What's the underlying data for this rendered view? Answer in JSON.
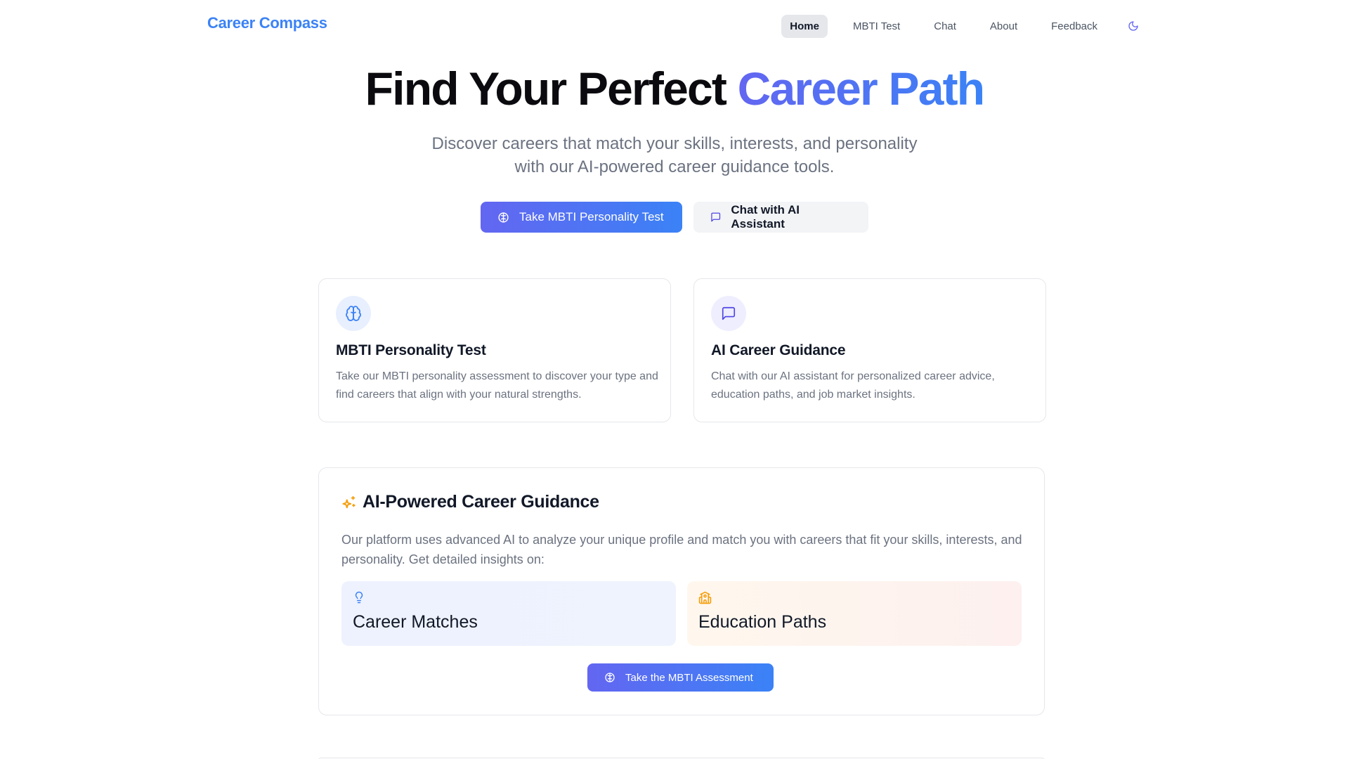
{
  "nav": {
    "brand": "Career Compass",
    "links": [
      "Home",
      "MBTI Test",
      "Chat",
      "About",
      "Feedback"
    ],
    "active": "Home",
    "theme_icon": "moon-icon"
  },
  "hero": {
    "title_main": "Find Your Perfect ",
    "title_accent": "Career Path",
    "subtitle_line1": "Discover careers that match your skills, interests, and personality",
    "subtitle_line2": "with our AI-powered career guidance tools.",
    "primary_button": "Take MBTI Personality Test",
    "secondary_button": "Chat with AI Assistant"
  },
  "features": [
    {
      "title": "MBTI Personality Test",
      "description": "Take our MBTI personality assessment to discover your type and find careers that align with your natural strengths.",
      "icon": "brain-icon"
    },
    {
      "title": "AI Career Guidance",
      "description": "Chat with our AI assistant for personalized career advice, education paths, and job market insights.",
      "icon": "message-square-icon"
    }
  ],
  "ai_section": {
    "title": "AI-Powered Career Guidance",
    "description": "Our platform uses advanced AI to analyze your unique profile and match you with careers that fit your skills, interests, and personality. Get detailed insights on:",
    "insights": [
      {
        "label": "Career Matches",
        "icon": "lightbulb-icon"
      },
      {
        "label": "Education Paths",
        "icon": "school-icon"
      }
    ],
    "button": "Take the MBTI Assessment"
  },
  "colors": {
    "brand": "#3b82f6",
    "accent_start": "#6366f1",
    "accent_end": "#3b82f6",
    "sparkle": "#f59e0b",
    "education": "#f59e0b"
  }
}
